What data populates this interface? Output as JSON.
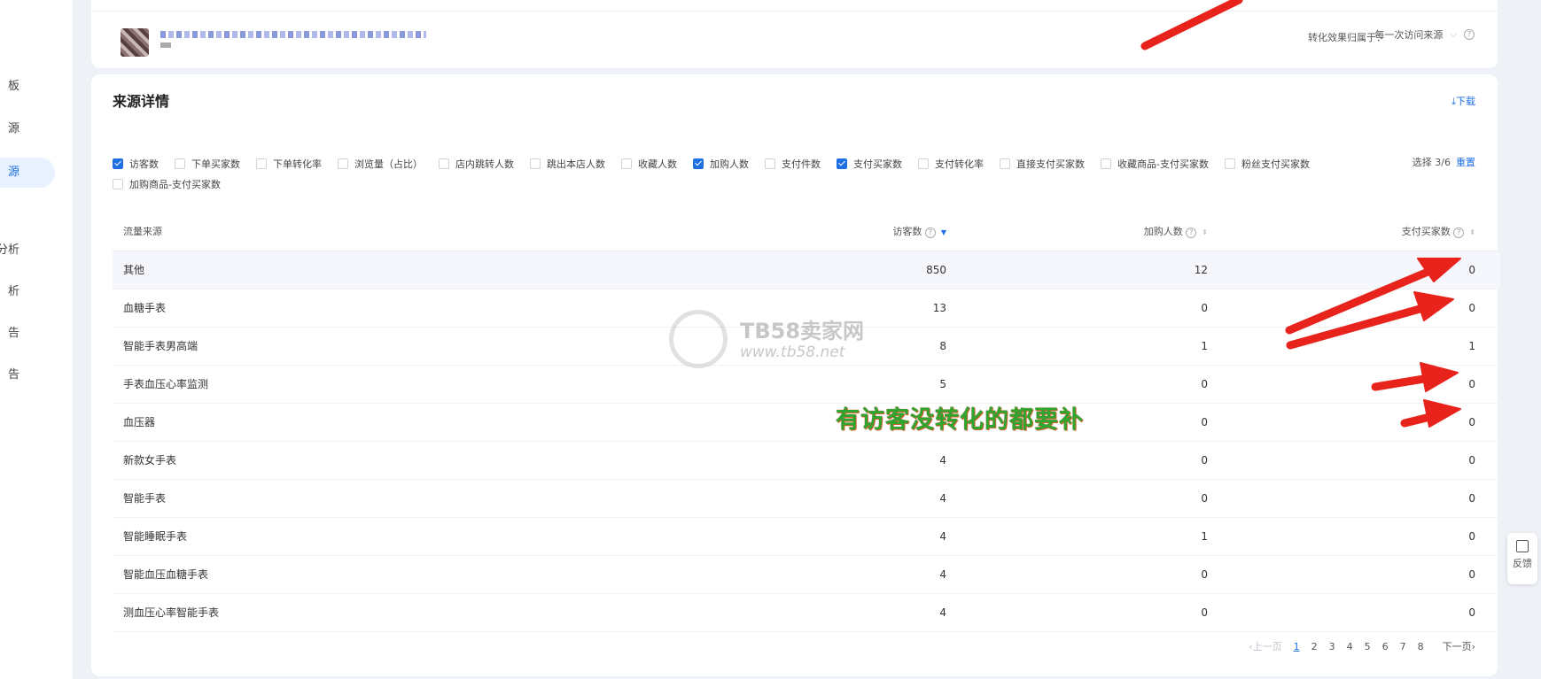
{
  "sidebar": {
    "items": [
      {
        "label": "板",
        "active": false
      },
      {
        "label": "源",
        "active": false
      },
      {
        "label": "源",
        "active": true
      },
      {
        "label": "",
        "active": false
      },
      {
        "label": "分析",
        "active": false
      },
      {
        "label": "析",
        "active": false
      },
      {
        "label": "告",
        "active": false
      },
      {
        "label": "告",
        "active": false
      }
    ]
  },
  "top": {
    "attribution_label": "转化效果归属于：",
    "attribution_value": "每一次访问来源"
  },
  "source_detail": {
    "title": "来源详情",
    "download": "下载",
    "filters": [
      {
        "label": "访客数",
        "checked": true
      },
      {
        "label": "下单买家数",
        "checked": false
      },
      {
        "label": "下单转化率",
        "checked": false
      },
      {
        "label": "浏览量（占比）",
        "checked": false
      },
      {
        "label": "店内跳转人数",
        "checked": false
      },
      {
        "label": "跳出本店人数",
        "checked": false
      },
      {
        "label": "收藏人数",
        "checked": false
      },
      {
        "label": "加购人数",
        "checked": true
      },
      {
        "label": "支付件数",
        "checked": false
      },
      {
        "label": "支付买家数",
        "checked": true
      },
      {
        "label": "支付转化率",
        "checked": false
      },
      {
        "label": "直接支付买家数",
        "checked": false
      },
      {
        "label": "收藏商品-支付买家数",
        "checked": false
      },
      {
        "label": "粉丝支付买家数",
        "checked": false
      },
      {
        "label": "加购商品-支付买家数",
        "checked": false
      }
    ],
    "select_count": "选择 3/6",
    "reset": "重置",
    "columns": {
      "source": "流量来源",
      "visitors": "访客数",
      "add_to_cart": "加购人数",
      "paying_buyers": "支付买家数"
    },
    "rows": [
      {
        "source": "其他",
        "visitors": "850",
        "add_to_cart": "12",
        "paying_buyers": "0"
      },
      {
        "source": "血糖手表",
        "visitors": "13",
        "add_to_cart": "0",
        "paying_buyers": "0"
      },
      {
        "source": "智能手表男高端",
        "visitors": "8",
        "add_to_cart": "1",
        "paying_buyers": "1"
      },
      {
        "source": "手表血压心率监测",
        "visitors": "5",
        "add_to_cart": "0",
        "paying_buyers": "0"
      },
      {
        "source": "血压器",
        "visitors": "",
        "add_to_cart": "0",
        "paying_buyers": "0"
      },
      {
        "source": "新款女手表",
        "visitors": "4",
        "add_to_cart": "0",
        "paying_buyers": "0"
      },
      {
        "source": "智能手表",
        "visitors": "4",
        "add_to_cart": "0",
        "paying_buyers": "0"
      },
      {
        "source": "智能睡眠手表",
        "visitors": "4",
        "add_to_cart": "1",
        "paying_buyers": "0"
      },
      {
        "source": "智能血压血糖手表",
        "visitors": "4",
        "add_to_cart": "0",
        "paying_buyers": "0"
      },
      {
        "source": "测血压心率智能手表",
        "visitors": "4",
        "add_to_cart": "0",
        "paying_buyers": "0"
      }
    ],
    "pagination": {
      "prev": "‹上一页",
      "pages": [
        "1",
        "2",
        "3",
        "4",
        "5",
        "6",
        "7",
        "8"
      ],
      "current": "1",
      "next": "下一页›"
    }
  },
  "feedback": "反馈",
  "watermark": {
    "title": "TB58卖家网",
    "url": "www.tb58.net"
  },
  "annotation": "有访客没转化的都要补",
  "colors": {
    "accent": "#1f6fe5",
    "annotation": "#2fa52f",
    "arrow": "#e8231b"
  }
}
